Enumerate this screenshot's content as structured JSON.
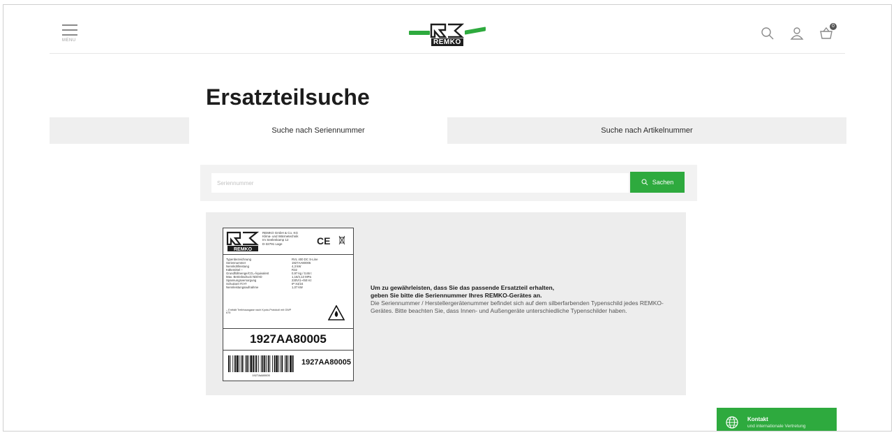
{
  "header": {
    "menu_label": "MENU",
    "logo_text": "REMKO",
    "cart_count": "0",
    "icons": [
      "menu-icon",
      "search-icon",
      "user-icon",
      "cart-icon"
    ]
  },
  "page": {
    "title": "Ersatzteilsuche"
  },
  "tabs": [
    {
      "label": "Suche nach Seriennummer",
      "active": true
    },
    {
      "label": "Suche nach Artikelnummer",
      "active": false
    }
  ],
  "search": {
    "placeholder": "Seriennummer",
    "value": "",
    "button_label": "Sachen"
  },
  "plate": {
    "company": [
      "REMKO GmbH & Co. KG",
      "Klima- und Wärmetechnik",
      "Im Seelenkamp 12",
      "D-32791 Lage"
    ],
    "ce_mark": "CE",
    "specs": [
      {
        "k": "Typenbezeichnung",
        "v": "RVL 400 DC S-Line"
      },
      {
        "k": "Seriennummer",
        "v": "1927AA80005"
      },
      {
        "k": "Nennkühlleistung",
        "v": "4,3 kW"
      },
      {
        "k": "Kältemittel –",
        "v": "R32"
      },
      {
        "k": "Grundfüllmenge/CO₂-Äquivalent",
        "v": "0,97 kg / 0,65 t"
      },
      {
        "k": "Max. Betriebsdruck ND/HD",
        "v": "1,16/4,13 MPa"
      },
      {
        "k": "Spannungsversorgung",
        "v": "230V/1~/50 Hz"
      },
      {
        "k": "Schutzart IT/AT",
        "v": "IP X4/24"
      },
      {
        "k": "Nennleistungsaufnahme",
        "v": "1,07 kW"
      }
    ],
    "note": "– Enthält Treibhausgase nach Kyoto-Protokoll mit GWP 675",
    "serial_large": "1927AA80005",
    "serial_small": "1927AA80005",
    "barcode_text": "1927AA80005"
  },
  "info": {
    "line1": "Um zu gewährleisten, dass Sie das passende Ersatzteil erhalten,",
    "line2": "geben Sie bitte die Seriennummer Ihres REMKO-Gerätes an.",
    "body": "Die Seriennummer / Herstellergerätenummer befindet sich auf dem silberfarbenden Typenschild jedes REMKO-Gerätes. Bitte beachten Sie, dass Innen- und Außengeräte unterschiedliche Typenschilder haben."
  },
  "contact": {
    "title": "Kontakt",
    "subtitle": "und internationale Vertretung"
  },
  "colors": {
    "brand_green": "#2eaa3e",
    "panel_grey": "#ededed"
  }
}
